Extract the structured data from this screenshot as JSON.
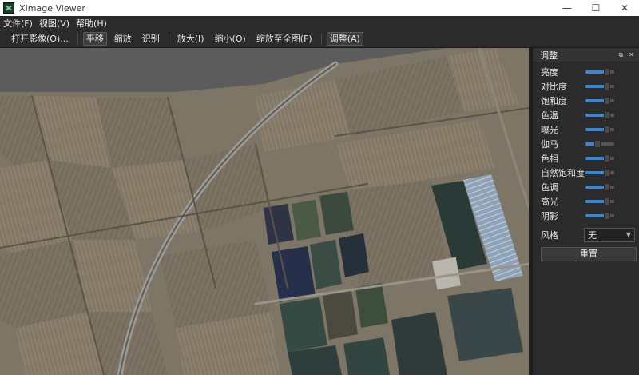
{
  "window": {
    "title": "XImage Viewer",
    "icon": "ximage-app-icon",
    "controls": {
      "minimize": "—",
      "maximize": "☐",
      "close": "✕"
    }
  },
  "menu": {
    "file": "文件(F)",
    "view": "视图(V)",
    "help": "帮助(H)"
  },
  "toolbar": {
    "open": "打开影像(O)...",
    "pan": "平移",
    "zoom": "缩放",
    "identify": "识别",
    "zoom_in": "放大(I)",
    "zoom_out": "缩小(O)",
    "zoom_full": "缩放至全图(F)",
    "adjust": "调整(A)",
    "active_tools": [
      "pan",
      "adjust"
    ]
  },
  "adjust_panel": {
    "title": "调整",
    "sliders": [
      {
        "label": "亮度",
        "level": 0.72
      },
      {
        "label": "对比度",
        "level": 0.72
      },
      {
        "label": "饱和度",
        "level": 0.72
      },
      {
        "label": "色温",
        "level": 0.72
      },
      {
        "label": "曝光",
        "level": 0.72
      },
      {
        "label": "伽马",
        "level": 0.38
      },
      {
        "label": "色相",
        "level": 0.72
      },
      {
        "label": "自然饱和度",
        "level": 0.72
      },
      {
        "label": "色调",
        "level": 0.72
      },
      {
        "label": "高光",
        "level": 0.72
      },
      {
        "label": "阴影",
        "level": 0.72
      }
    ],
    "style_label": "风格",
    "style_value": "无",
    "reset_label": "重置"
  },
  "colors": {
    "accent": "#3a86d4",
    "panel_bg": "#2b2b2b",
    "map_background": "#5a5a5a"
  }
}
